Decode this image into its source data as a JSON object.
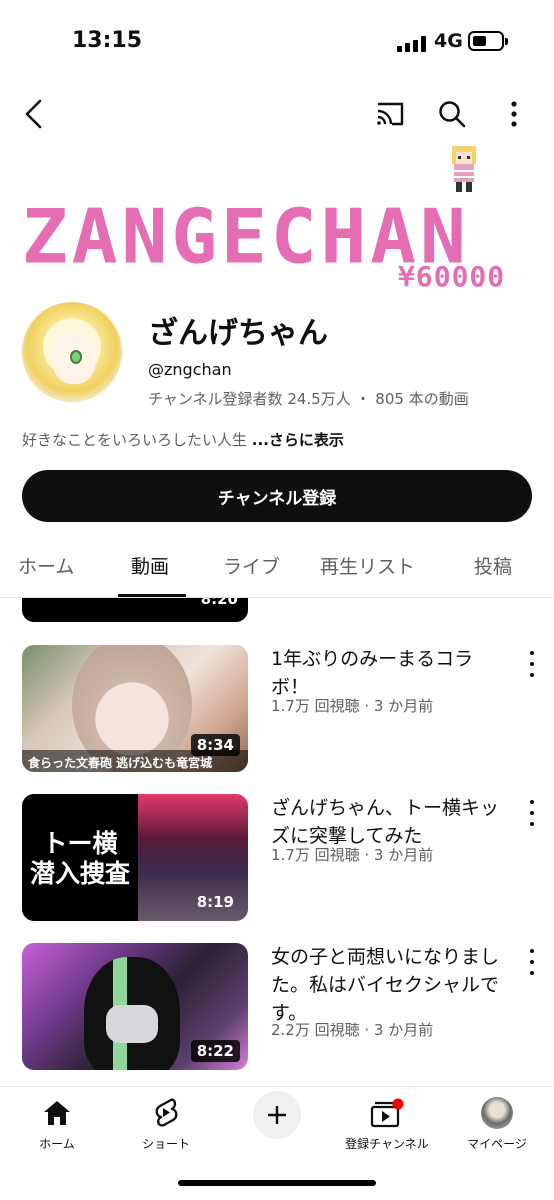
{
  "status_bar": {
    "time": "13:15",
    "network": "4G"
  },
  "banner": {
    "logo_text": "ZANGECHAN",
    "price_text": "¥60000"
  },
  "channel": {
    "name": "ざんげちゃん",
    "handle": "@zngchan",
    "subscribers": "チャンネル登録者数 24.5万人",
    "separator": "・",
    "video_count": "805 本の動画",
    "description": "好きなことをいろいろしたい人生",
    "more_label": "...さらに表示",
    "subscribe_label": "チャンネル登録"
  },
  "tabs": [
    {
      "label": "ホーム"
    },
    {
      "label": "動画"
    },
    {
      "label": "ライブ"
    },
    {
      "label": "再生リスト"
    },
    {
      "label": "投稿"
    }
  ],
  "active_tab": "動画",
  "partial_video": {
    "duration": "8:20"
  },
  "videos": [
    {
      "title": "1年ぶりのみーまるコラボ！",
      "meta": "1.7万 回視聴 · 3 か月前",
      "duration": "8:34",
      "thumb_caption": "食らった文春砲 逃げ込むも竜宮城"
    },
    {
      "title": "ざんげちゃん、トー横キッズに突撃してみた",
      "meta": "1.7万 回視聴 · 3 か月前",
      "duration": "8:19",
      "thumb_line1": "トー横",
      "thumb_line2": "潜入捜査"
    },
    {
      "title": "女の子と両想いになりました。私はバイセクシャルです。",
      "meta": "2.2万 回視聴 · 3 か月前",
      "duration": "8:22"
    }
  ],
  "bottom_nav": [
    {
      "label": "ホーム",
      "icon": "home-icon"
    },
    {
      "label": "ショート",
      "icon": "shorts-icon"
    },
    {
      "label": "",
      "icon": "plus-icon"
    },
    {
      "label": "登録チャンネル",
      "icon": "subscriptions-icon"
    },
    {
      "label": "マイページ",
      "icon": "avatar"
    }
  ],
  "colors": {
    "accent_pink": "#e56db3",
    "text_primary": "#0f0f0f",
    "text_secondary": "#606060",
    "notification_red": "#ff0000"
  }
}
